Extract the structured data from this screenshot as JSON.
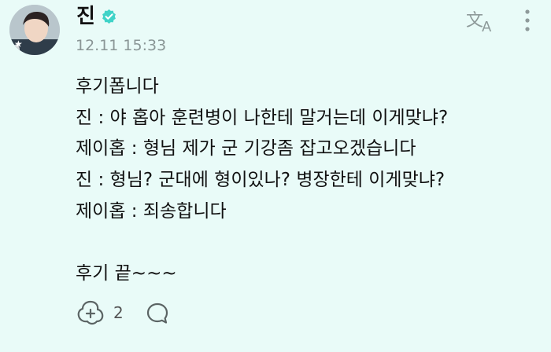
{
  "post": {
    "author": "진",
    "timestamp": "12.11 15:33",
    "body": "후기폽니다\n진 : 야 홉아 훈련병이 나한테 말거는데 이게맞냐?\n제이홉 : 형님 제가 군 기강좀 잡고오겠습니다\n진 : 형님? 군대에 형이있나? 병장한테 이게맞냐?\n제이홉 : 죄송합니다\n\n후기 끝~~~",
    "reaction_count": "2"
  },
  "icons": {
    "verified": "verified-badge-icon",
    "translate": "translate-icon",
    "more": "more-vertical-icon",
    "reaction": "reaction-icon",
    "comment": "comment-icon"
  },
  "colors": {
    "background": "#e9fbf8",
    "verified": "#3fd3c8",
    "muted": "#8a9696"
  }
}
